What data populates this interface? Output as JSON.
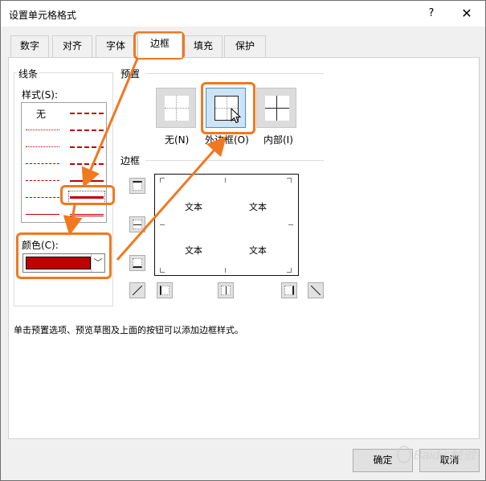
{
  "window": {
    "title": "设置单元格格式",
    "help_label": "?",
    "close_label": "✕"
  },
  "tabs": [
    {
      "label": "数字",
      "active": false
    },
    {
      "label": "对齐",
      "active": false
    },
    {
      "label": "字体",
      "active": false
    },
    {
      "label": "边框",
      "active": true
    },
    {
      "label": "填充",
      "active": false
    },
    {
      "label": "保护",
      "active": false
    }
  ],
  "line_group": {
    "title": "线条",
    "style_label": "样式(S):",
    "none_label": "无",
    "color_label": "颜色(C):",
    "selected_color": "#c00000"
  },
  "presets": {
    "title": "预置",
    "items": [
      {
        "label": "无(N)"
      },
      {
        "label": "外边框(O)"
      },
      {
        "label": "内部(I)"
      }
    ]
  },
  "border": {
    "title": "边框",
    "preview_text": [
      "文本",
      "文本",
      "文本",
      "文本"
    ]
  },
  "hint": "单击预置选项、预览草图及上面的按钮可以添加边框样式。",
  "buttons": {
    "ok": "确定",
    "cancel": "取消"
  },
  "watermark": "Baidu 经验",
  "colors": {
    "annotation": "#f07820",
    "accent_red": "#c00000"
  }
}
